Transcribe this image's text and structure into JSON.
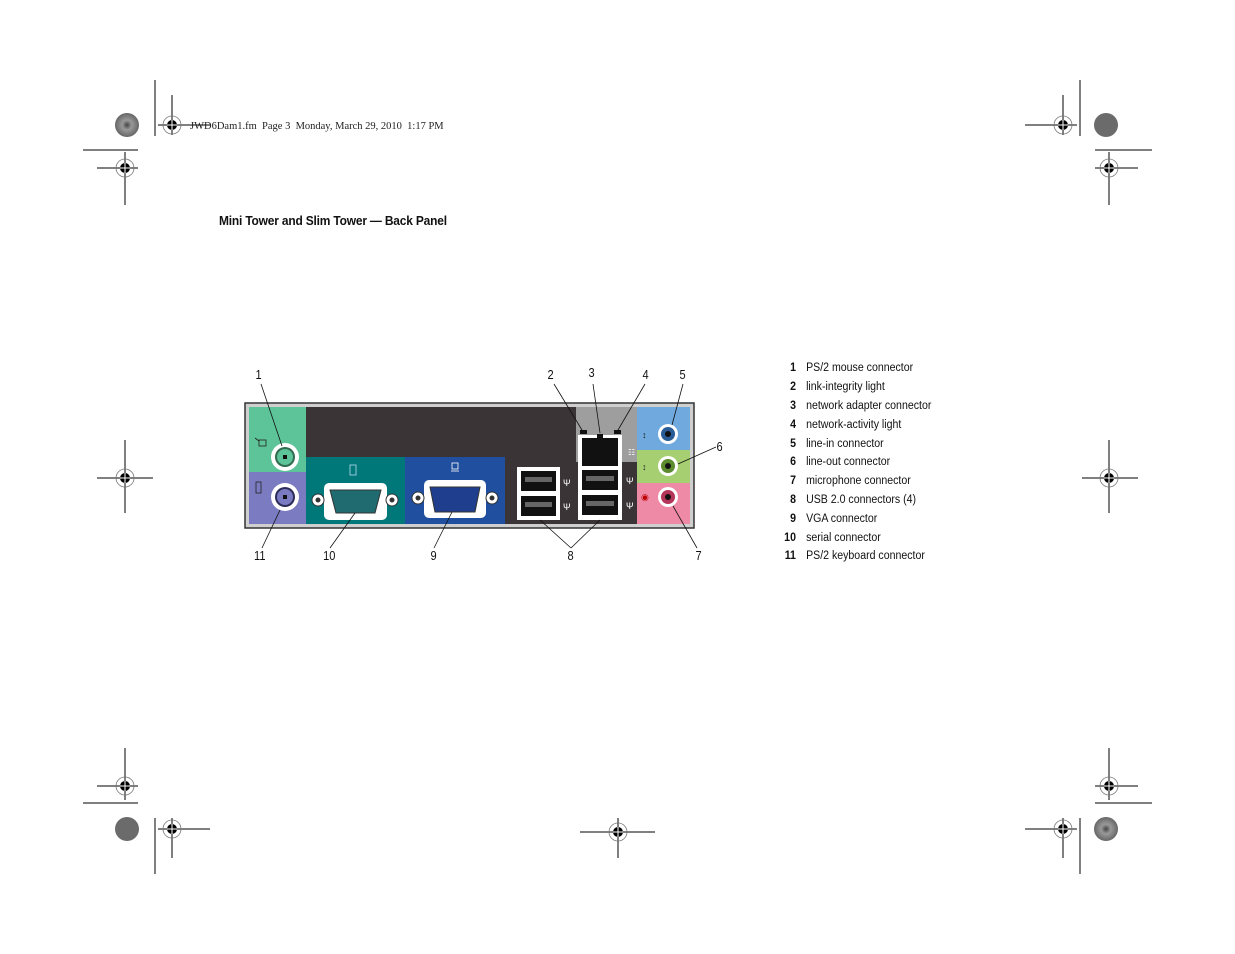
{
  "header": {
    "file_info": "JWD6Dam1.fm  Page 3  Monday, March 29, 2010  1:17 PM"
  },
  "section": {
    "title": "Mini Tower and Slim Tower — Back Panel"
  },
  "figure": {
    "callouts": [
      "1",
      "2",
      "3",
      "4",
      "5",
      "6",
      "7",
      "8",
      "9",
      "10",
      "11"
    ],
    "port_icons": {
      "ps2_mouse": "mouse-icon",
      "ps2_keyboard": "keyboard-icon",
      "serial": "serial-port-icon",
      "vga": "monitor-icon",
      "usb": "usb-icon",
      "network": "network-icon",
      "line_in": "line-in-icon",
      "line_out": "line-out-icon",
      "microphone": "microphone-icon"
    },
    "colors": {
      "ps2_mouse": "#5dc398",
      "ps2_keyboard": "#7b7bc2",
      "serial": "#00787a",
      "vga": "#1f4f9e",
      "panel": "#3a3436",
      "network_bg": "#9e9e9e",
      "line_in": "#6fa9de",
      "line_out": "#a6cf72",
      "microphone": "#ef8aa6"
    }
  },
  "legend": {
    "items": [
      {
        "num": "1",
        "label": "PS/2 mouse connector"
      },
      {
        "num": "2",
        "label": "link-integrity light"
      },
      {
        "num": "3",
        "label": "network adapter connector"
      },
      {
        "num": "4",
        "label": "network-activity light"
      },
      {
        "num": "5",
        "label": "line-in connector"
      },
      {
        "num": "6",
        "label": "line-out connector"
      },
      {
        "num": "7",
        "label": "microphone connector"
      },
      {
        "num": "8",
        "label": "USB 2.0 connectors (4)"
      },
      {
        "num": "9",
        "label": "VGA connector"
      },
      {
        "num": "10",
        "label": "serial connector"
      },
      {
        "num": "11",
        "label": "PS/2 keyboard connector"
      }
    ]
  }
}
